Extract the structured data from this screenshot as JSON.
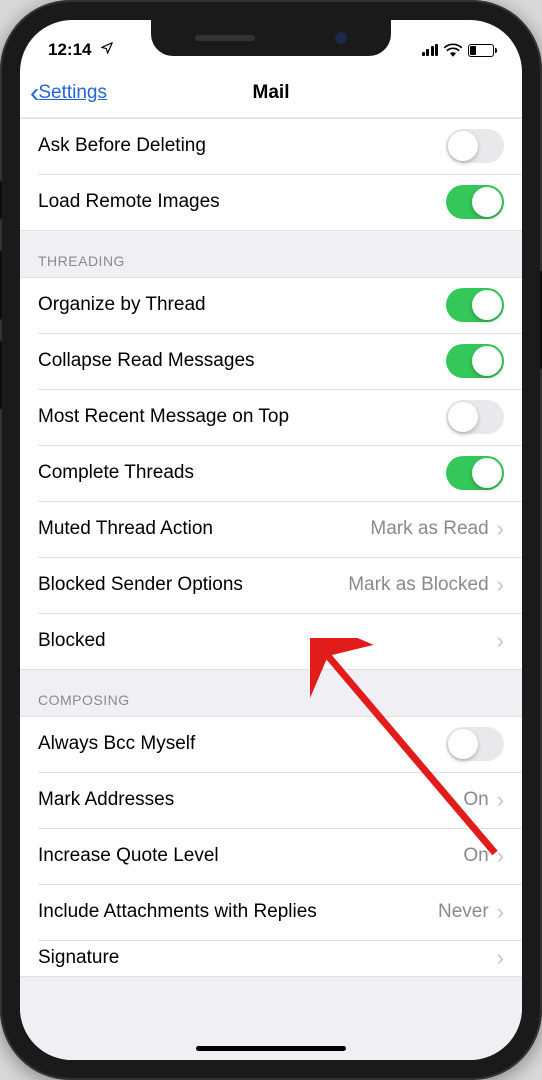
{
  "status": {
    "time": "12:14"
  },
  "nav": {
    "back_label": "Settings",
    "title": "Mail"
  },
  "sections": {
    "top": {
      "ask_before_deleting": {
        "label": "Ask Before Deleting",
        "on": false
      },
      "load_remote_images": {
        "label": "Load Remote Images",
        "on": true
      }
    },
    "threading": {
      "header": "THREADING",
      "organize_by_thread": {
        "label": "Organize by Thread",
        "on": true
      },
      "collapse_read": {
        "label": "Collapse Read Messages",
        "on": true
      },
      "most_recent_top": {
        "label": "Most Recent Message on Top",
        "on": false
      },
      "complete_threads": {
        "label": "Complete Threads",
        "on": true
      },
      "muted_action": {
        "label": "Muted Thread Action",
        "value": "Mark as Read"
      },
      "blocked_sender": {
        "label": "Blocked Sender Options",
        "value": "Mark as Blocked"
      },
      "blocked": {
        "label": "Blocked"
      }
    },
    "composing": {
      "header": "COMPOSING",
      "always_bcc": {
        "label": "Always Bcc Myself",
        "on": false
      },
      "mark_addresses": {
        "label": "Mark Addresses",
        "value": "On"
      },
      "increase_quote": {
        "label": "Increase Quote Level",
        "value": "On"
      },
      "include_attachments": {
        "label": "Include Attachments with Replies",
        "value": "Never"
      },
      "signature": {
        "label": "Signature"
      }
    }
  }
}
